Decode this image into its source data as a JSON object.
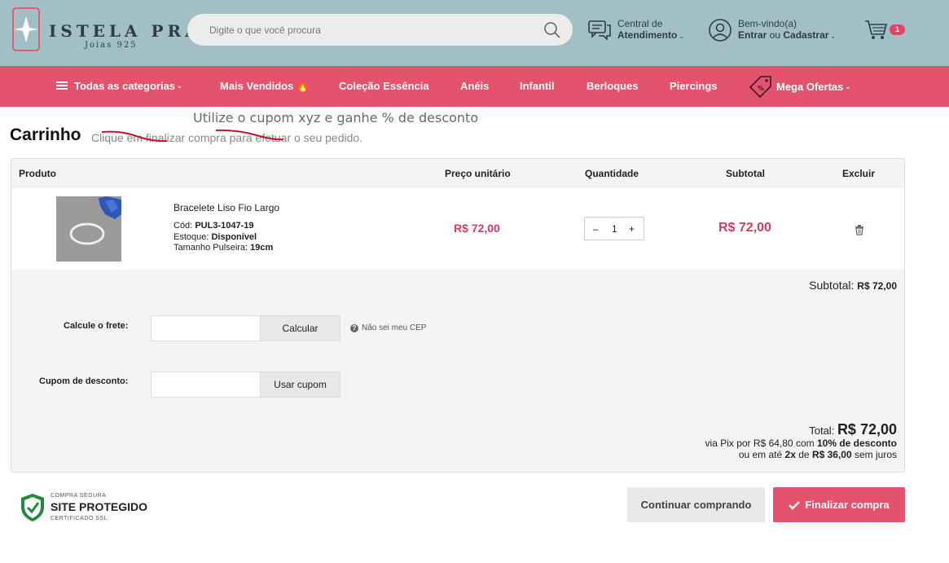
{
  "brand": {
    "name": "ISTELA PRATAS",
    "tagline": "Joias 925"
  },
  "search": {
    "placeholder": "Digite o que você procura"
  },
  "support": {
    "line1": "Central de",
    "line2": "Atendimento"
  },
  "account": {
    "line1": "Bem-vindo(a)",
    "login": "Entrar",
    "or": "ou",
    "register": "Cadastrar"
  },
  "cart": {
    "count": "1"
  },
  "nav": {
    "all_categories": "Todas as categorias",
    "items": [
      "Mais Vendidos 🔥",
      "Coleção Essência",
      "Anéis",
      "Infantil",
      "Berloques",
      "Piercings"
    ],
    "offers": "Mega Ofertas"
  },
  "annotation": "Utilize o cupom xyz e ganhe % de desconto",
  "page": {
    "title": "Carrinho",
    "subtitle": "Clique em finalizar compra para efetuar o seu pedido."
  },
  "table": {
    "headers": {
      "product": "Produto",
      "unit_price": "Preço unitário",
      "quantity": "Quantidade",
      "subtotal": "Subtotal",
      "remove": "Excluir"
    },
    "row": {
      "name": "Bracelete Liso Fio Largo",
      "code_label": "Cód:",
      "code": "PUL3-1047-19",
      "stock_label": "Estoque:",
      "stock": "Disponível",
      "size_label": "Tamanho Pulseira:",
      "size": "19cm",
      "unit_price": "R$ 72,00",
      "qty": "1",
      "subtotal": "R$ 72,00"
    }
  },
  "summary": {
    "subtotal_label": "Subtotal:",
    "subtotal": "R$ 72,00",
    "shipping_label": "Calcule o frete:",
    "shipping_button": "Calcular",
    "cep_help": "Não sei meu CEP",
    "coupon_label": "Cupom de desconto:",
    "coupon_button": "Usar cupom",
    "total_label": "Total:",
    "total": "R$ 72,00",
    "pix_prefix": "via Pix por",
    "pix_value": "R$ 64,80",
    "pix_mid": "com",
    "pix_discount": "10% de desconto",
    "inst_prefix": "ou em até",
    "inst_times": "2x",
    "inst_mid": "de",
    "inst_value": "R$ 36,00",
    "inst_suffix": "sem juros"
  },
  "seal": {
    "top": "COMPRA SEGURA",
    "main": "SITE PROTEGIDO",
    "bottom": "CERTIFICADO SSL"
  },
  "buttons": {
    "continue": "Continuar comprando",
    "finish": "Finalizar compra"
  },
  "colors": {
    "header_bg": "#a3bfc6",
    "nav_bg": "#e4536d",
    "price": "#d23e5f"
  }
}
